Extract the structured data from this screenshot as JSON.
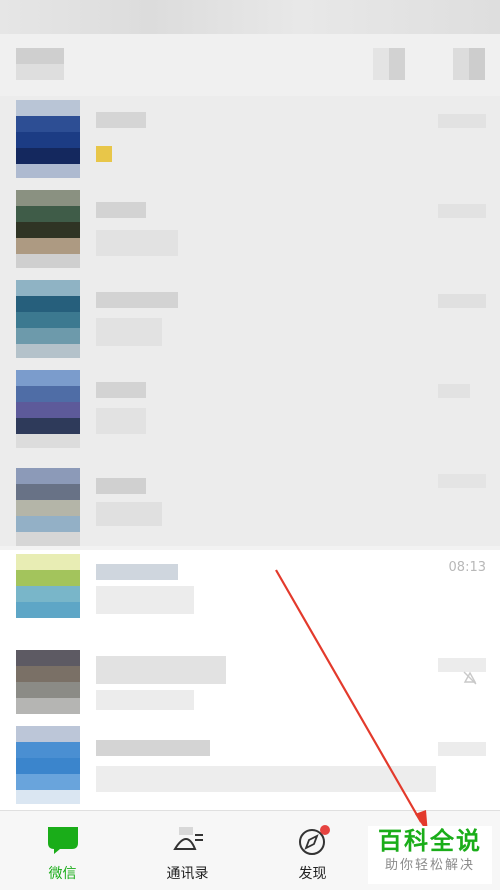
{
  "chats": [
    {
      "time": ""
    },
    {
      "time": ""
    },
    {
      "time": ""
    },
    {
      "time": ""
    },
    {
      "time": ""
    },
    {
      "time": "08:13"
    },
    {
      "time": ""
    },
    {
      "time": ""
    }
  ],
  "tabs": [
    {
      "label": "微信",
      "icon": "chat-icon",
      "active": true
    },
    {
      "label": "通讯录",
      "icon": "contacts-icon",
      "active": false
    },
    {
      "label": "发现",
      "icon": "compass-icon",
      "active": false
    }
  ],
  "watermark": {
    "title": "百科全说",
    "subtitle": "助你轻松解决"
  },
  "colors": {
    "accent": "#1aad19",
    "badge": "#e64340",
    "arrow": "#e33a2c"
  }
}
